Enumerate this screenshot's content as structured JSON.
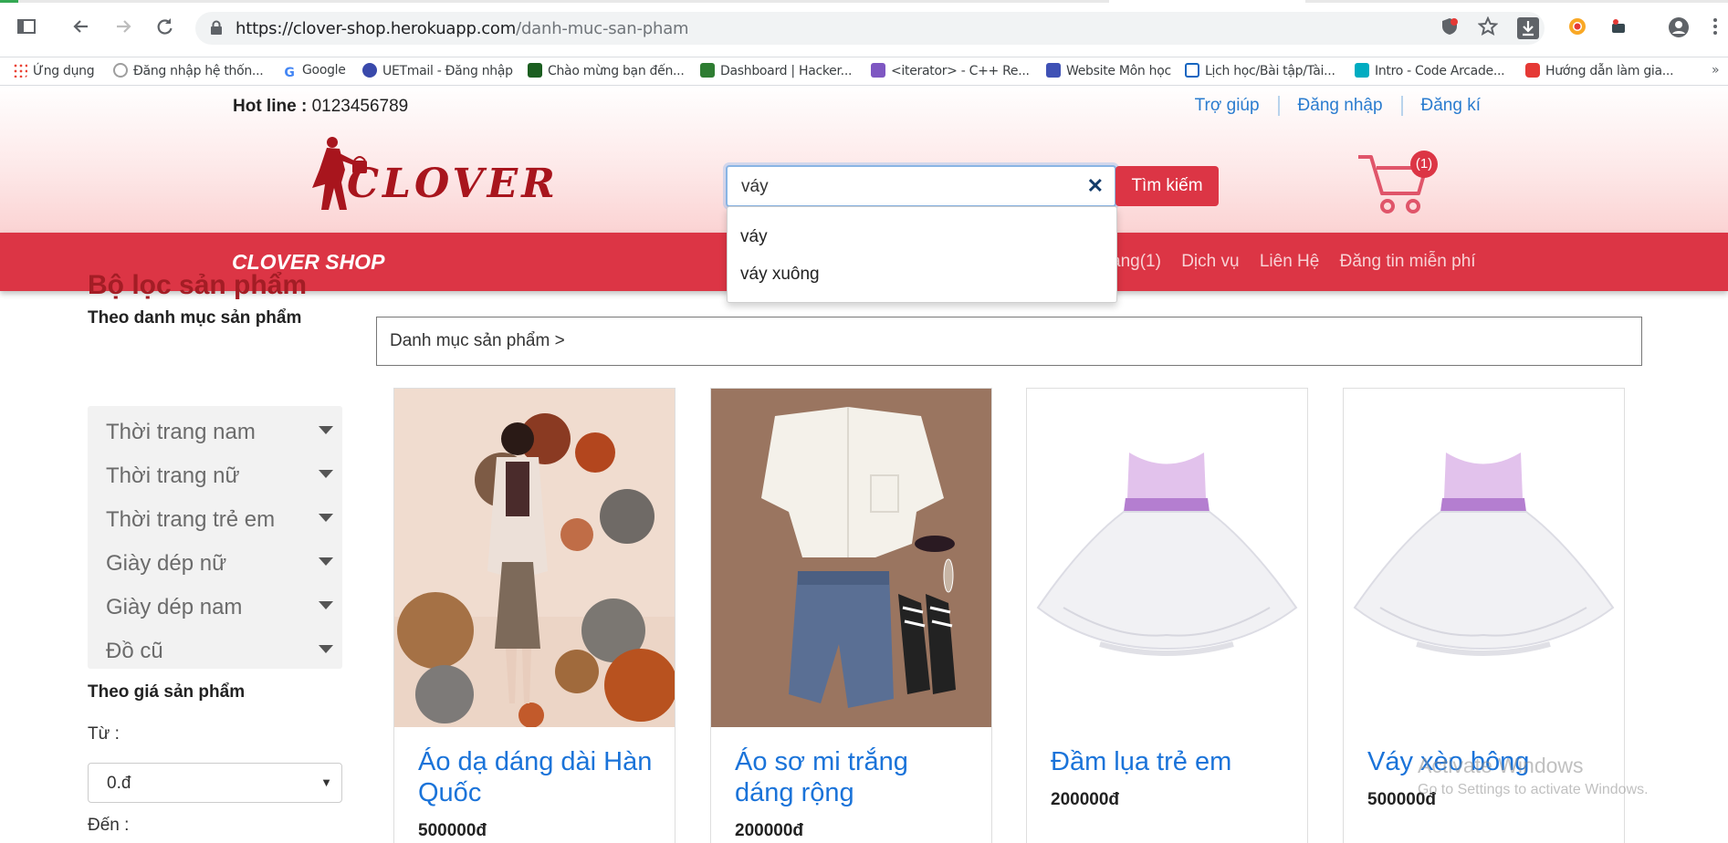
{
  "browser": {
    "url_host": "https://clover-shop.herokuapp.com",
    "url_path": "/danh-muc-san-pham",
    "bookmarks": [
      {
        "label": "Ứng dụng",
        "color": "#ea4335"
      },
      {
        "label": "Đăng nhập hệ thốn...",
        "color": "#9e9e9e"
      },
      {
        "label": "Google",
        "color": "#4285f4"
      },
      {
        "label": "UETmail - Đăng nhập",
        "color": "#3949ab"
      },
      {
        "label": "Chào mừng bạn đến...",
        "color": "#1b5e20"
      },
      {
        "label": "Dashboard | Hacker...",
        "color": "#2e7d32"
      },
      {
        "label": "<iterator> - C++ Re...",
        "color": "#7e57c2"
      },
      {
        "label": "Website Môn học",
        "color": "#3f51b5"
      },
      {
        "label": "Lịch học/Bài tập/Tài...",
        "color": "#1565c0"
      },
      {
        "label": "Intro - Code Arcade...",
        "color": "#00acc1"
      },
      {
        "label": "Hướng dẫn làm gia...",
        "color": "#e53935"
      }
    ]
  },
  "header": {
    "hotline_label": "Hot line :",
    "hotline_number": "0123456789",
    "links": [
      "Trợ giúp",
      "Đăng nhập",
      "Đăng kí"
    ],
    "logo_text": "CLOVER",
    "search_value": "váy",
    "search_button": "Tìm kiếm",
    "cart_count": "(1)"
  },
  "autocomplete": [
    "váy",
    "váy xuông"
  ],
  "navbar": {
    "brand": "CLOVER SHOP",
    "links": [
      "àng(1)",
      "Dịch vụ",
      "Liên Hệ",
      "Đăng tin miễn phí"
    ]
  },
  "sidebar": {
    "title": "Bộ lọc sản phẩm",
    "category_title": "Theo danh mục sản phẩm",
    "categories": [
      "Thời trang nam",
      "Thời trang nữ",
      "Thời trang trẻ em",
      "Giày dép nữ",
      "Giày dép nam",
      "Đồ cũ"
    ],
    "price_title": "Theo giá sản phẩm",
    "from_label": "Từ :",
    "from_value": "0.đ",
    "to_label": "Đến :"
  },
  "breadcrumb": "Danh mục sản phẩm >",
  "products": [
    {
      "name": "Áo dạ dáng dài Hàn Quốc",
      "price": "500000đ"
    },
    {
      "name": "Áo sơ mi trắng dáng rộng",
      "price": "200000đ"
    },
    {
      "name": "Đầm lụa trẻ em",
      "price": "200000đ"
    },
    {
      "name": "Váy xèo bông",
      "price": "500000đ"
    }
  ],
  "watermark": {
    "line1": "Activate Windows",
    "line2": "Go to Settings to activate Windows."
  },
  "colors": {
    "brand_red": "#dc3545",
    "link_blue": "#1a73d9",
    "title_red": "#a31d25"
  }
}
